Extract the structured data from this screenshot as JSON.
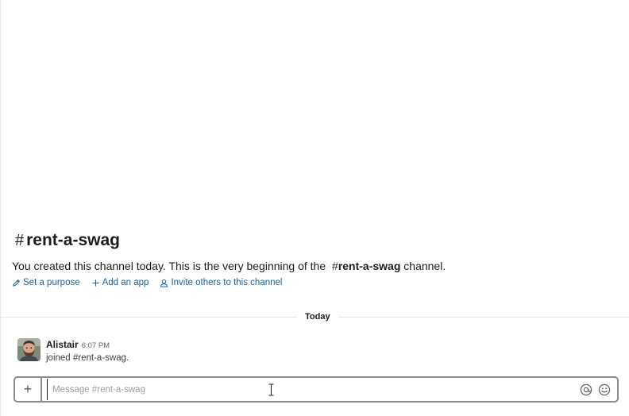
{
  "channel": {
    "hash": "#",
    "name": "rent-a-swag",
    "intro_text": "You created this channel today. This is the very beginning of the",
    "intro_ref_hash": "#",
    "intro_ref_name": "rent-a-swag",
    "intro_suffix": " channel.",
    "actions": [
      {
        "label": "Set a purpose",
        "icon": "pencil-icon"
      },
      {
        "label": "Add an app",
        "icon": "plus-icon"
      },
      {
        "label": "Invite others to this channel",
        "icon": "person-icon"
      }
    ]
  },
  "divider": {
    "label": "Today"
  },
  "messages": [
    {
      "author": "Alistair",
      "time": "6:07 PM",
      "text": "joined #rent-a-swag.",
      "avatar": "user-avatar"
    }
  ],
  "composer": {
    "plus_label": "+",
    "placeholder": "Message #rent-a-swag",
    "value": "",
    "icons": [
      "at-icon",
      "emoji-icon"
    ]
  },
  "colors": {
    "link": "#1264a3",
    "text": "#1d1c1d",
    "muted": "#616061",
    "border": "#8e8d8e"
  }
}
